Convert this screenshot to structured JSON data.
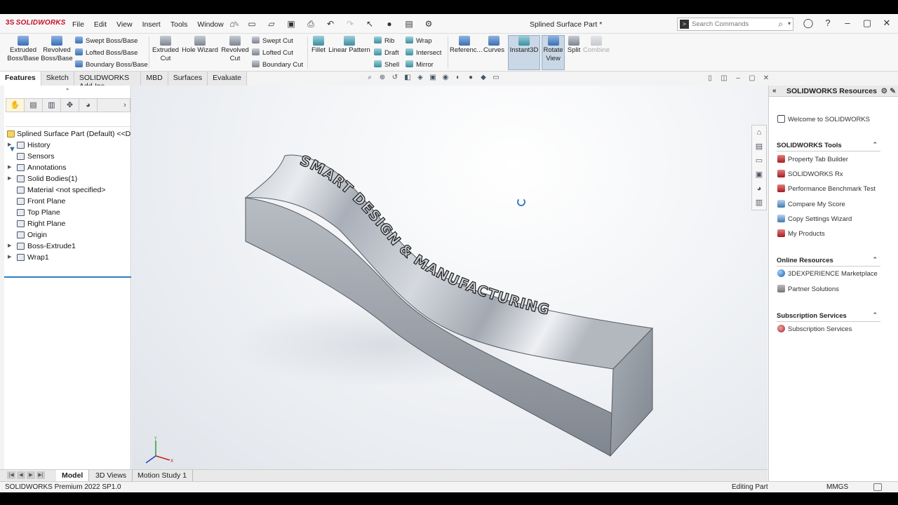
{
  "app": {
    "brand": "SOLIDWORKS",
    "document_title": "Splined Surface Part *"
  },
  "menu": [
    "File",
    "Edit",
    "View",
    "Insert",
    "Tools",
    "Window"
  ],
  "search": {
    "placeholder": "Search Commands"
  },
  "ribbon": {
    "extruded_boss": "Extruded Boss/Base",
    "revolved_boss": "Revolved Boss/Base",
    "swept_boss": "Swept Boss/Base",
    "lofted_boss": "Lofted Boss/Base",
    "boundary_boss": "Boundary Boss/Base",
    "extruded_cut": "Extruded Cut",
    "hole_wizard": "Hole Wizard",
    "revolved_cut": "Revolved Cut",
    "swept_cut": "Swept Cut",
    "lofted_cut": "Lofted Cut",
    "boundary_cut": "Boundary Cut",
    "fillet": "Fillet",
    "linear_pattern": "Linear Pattern",
    "rib": "Rib",
    "draft": "Draft",
    "shell": "Shell",
    "wrap": "Wrap",
    "intersect": "Intersect",
    "mirror": "Mirror",
    "reference": "Referenc...",
    "curves": "Curves",
    "instant3d": "Instant3D",
    "rotate_view": "Rotate View",
    "split": "Split",
    "combine": "Combine"
  },
  "command_tabs": [
    "Features",
    "Sketch",
    "SOLIDWORKS Add-Ins",
    "MBD",
    "Surfaces",
    "Evaluate"
  ],
  "feature_tree": {
    "root": "Splined Surface Part (Default) <<Def",
    "items": [
      {
        "label": "History",
        "expandable": true
      },
      {
        "label": "Sensors",
        "expandable": false
      },
      {
        "label": "Annotations",
        "expandable": true
      },
      {
        "label": "Solid Bodies(1)",
        "expandable": true
      },
      {
        "label": "Material <not specified>",
        "expandable": false
      },
      {
        "label": "Front Plane",
        "expandable": false
      },
      {
        "label": "Top Plane",
        "expandable": false
      },
      {
        "label": "Right Plane",
        "expandable": false
      },
      {
        "label": "Origin",
        "expandable": false
      },
      {
        "label": "Boss-Extrude1",
        "expandable": true
      },
      {
        "label": "Wrap1",
        "expandable": true
      }
    ]
  },
  "model": {
    "embossed_text": "SMART DESIGN & MANUFACTURING",
    "colors": {
      "body_light": "#e7eaee",
      "body_mid": "#b7bcc4",
      "body_dark": "#7d838c",
      "text_stroke": "#1a1a1a"
    }
  },
  "resources": {
    "title": "SOLIDWORKS Resources",
    "welcome": "Welcome to SOLIDWORKS",
    "tools_header": "SOLIDWORKS Tools",
    "tools": [
      "Property Tab Builder",
      "SOLIDWORKS Rx",
      "Performance Benchmark Test",
      "Compare My Score",
      "Copy Settings Wizard",
      "My Products"
    ],
    "online_header": "Online Resources",
    "online": [
      "3DEXPERIENCE Marketplace",
      "Partner Solutions"
    ],
    "subscription_header": "Subscription Services",
    "subscription": [
      "Subscription Services"
    ]
  },
  "bottom_tabs": [
    "Model",
    "3D Views",
    "Motion Study 1"
  ],
  "status": {
    "version": "SOLIDWORKS Premium 2022 SP1.0",
    "mode": "Editing Part",
    "units": "MMGS"
  },
  "triad": {
    "y": "Y",
    "x": "X"
  }
}
